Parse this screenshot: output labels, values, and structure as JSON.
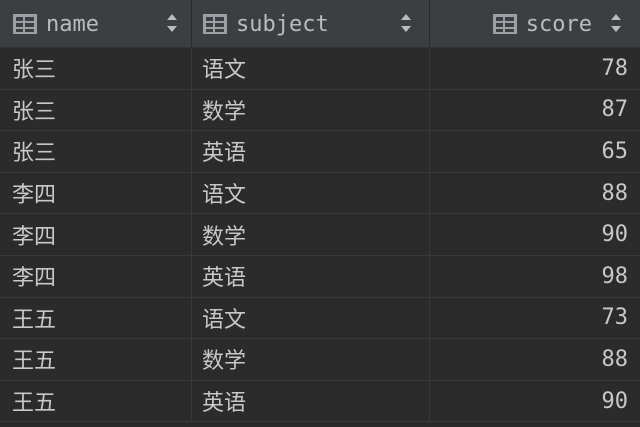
{
  "columns": [
    {
      "label": "name",
      "icon": "table-column-icon",
      "sort_icon": "sort-arrows-icon"
    },
    {
      "label": "subject",
      "icon": "table-column-icon",
      "sort_icon": "sort-arrows-icon"
    },
    {
      "label": "score",
      "icon": "table-column-icon",
      "sort_icon": "sort-arrows-icon"
    }
  ],
  "rows": [
    {
      "name": "张三",
      "subject": "语文",
      "score": "78"
    },
    {
      "name": "张三",
      "subject": "数学",
      "score": "87"
    },
    {
      "name": "张三",
      "subject": "英语",
      "score": "65"
    },
    {
      "name": "李四",
      "subject": "语文",
      "score": "88"
    },
    {
      "name": "李四",
      "subject": "数学",
      "score": "90"
    },
    {
      "name": "李四",
      "subject": "英语",
      "score": "98"
    },
    {
      "name": "王五",
      "subject": "语文",
      "score": "73"
    },
    {
      "name": "王五",
      "subject": "数学",
      "score": "88"
    },
    {
      "name": "王五",
      "subject": "英语",
      "score": "90"
    }
  ],
  "colors": {
    "background": "#2b2b2b",
    "header_background": "#3c3f41",
    "text": "#c8c8c8",
    "grid_line": "#3a3a3a"
  }
}
